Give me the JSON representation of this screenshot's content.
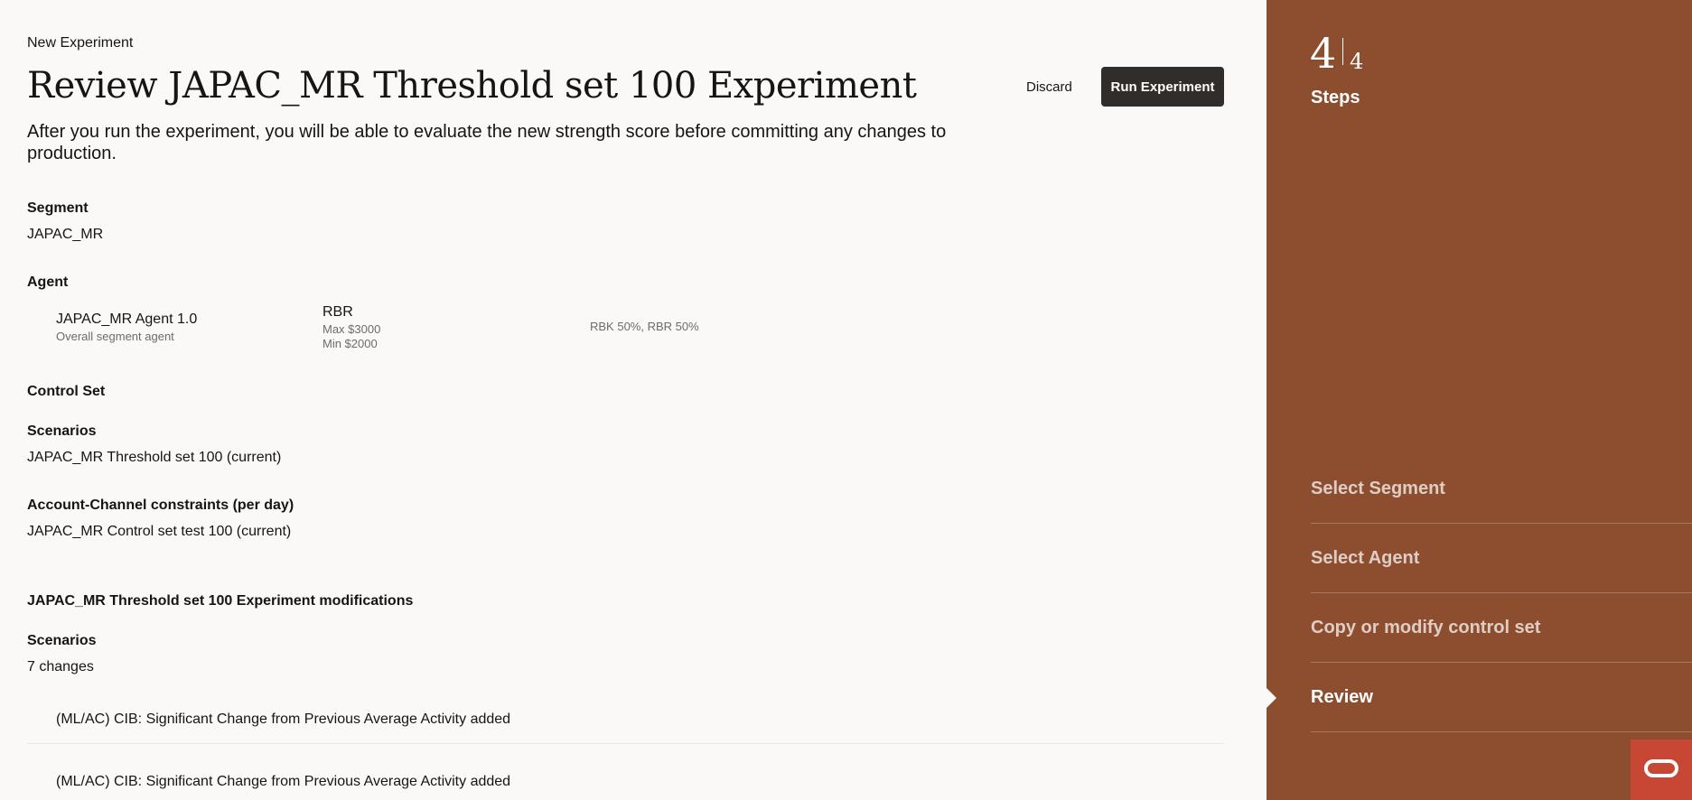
{
  "header": {
    "breadcrumb": "New Experiment",
    "title": "Review JAPAC_MR Threshold set 100 Experiment",
    "discard_label": "Discard",
    "run_label": "Run Experiment",
    "subtitle": "After you run the experiment, you will be able to evaluate the new strength score before committing any changes to production."
  },
  "segment": {
    "label": "Segment",
    "value": "JAPAC_MR"
  },
  "agent": {
    "label": "Agent",
    "name": "JAPAC_MR Agent 1.0",
    "description": "Overall segment agent",
    "rbr_title": "RBR",
    "rbr_max": "Max $3000",
    "rbr_min": "Min $2000",
    "split": "RBK 50%, RBR 50%"
  },
  "control_set": {
    "label": "Control Set",
    "scenarios_label": "Scenarios",
    "scenarios_value": "JAPAC_MR Threshold set 100 (current)",
    "constraints_label": "Account-Channel constraints (per day)",
    "constraints_value": "JAPAC_MR Control set test 100 (current)"
  },
  "modifications": {
    "label": "JAPAC_MR Threshold set 100 Experiment modifications",
    "scenarios_label": "Scenarios",
    "changes_count": "7 changes",
    "items": [
      "(ML/AC) CIB: Significant Change from Previous Average Activity added",
      "(ML/AC) CIB: Significant Change from Previous Average Activity added"
    ]
  },
  "sidebar": {
    "current_step": "4",
    "total_steps": "4",
    "steps_label": "Steps",
    "steps": [
      {
        "label": "Select Segment"
      },
      {
        "label": "Select Agent"
      },
      {
        "label": "Copy or modify control set"
      },
      {
        "label": "Review"
      }
    ],
    "active_step_index": 3
  },
  "colors": {
    "sidebar_bg": "#8c4e2f",
    "primary_button": "#312d2a",
    "oracle_red": "#c74634",
    "page_bg": "#faf9f8"
  },
  "icons": {
    "oracle_launcher": "oracle-logo-icon"
  }
}
